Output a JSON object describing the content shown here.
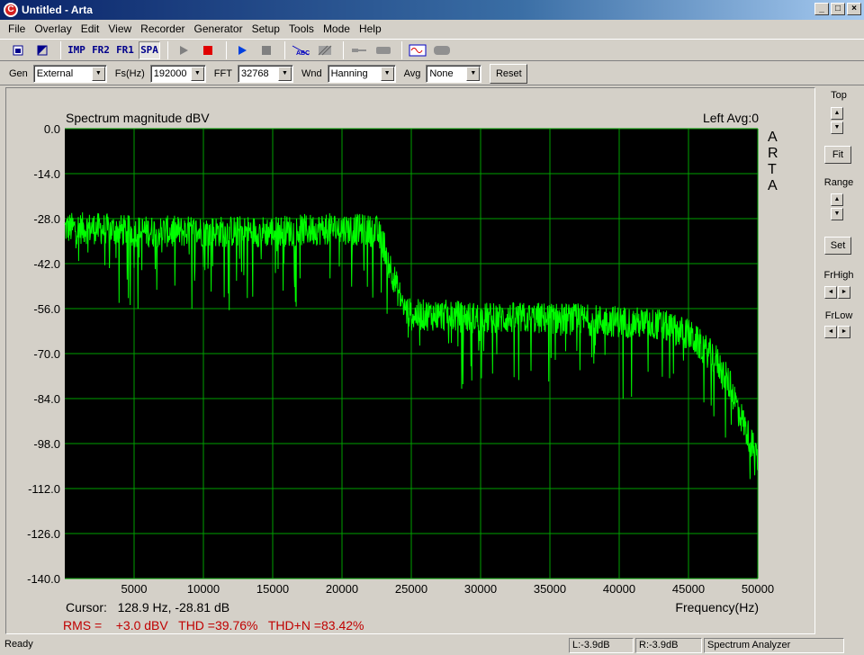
{
  "window": {
    "title": "Untitled - Arta",
    "icon_letter": "C"
  },
  "menu": [
    "File",
    "Overlay",
    "Edit",
    "View",
    "Recorder",
    "Generator",
    "Setup",
    "Tools",
    "Mode",
    "Help"
  ],
  "toolbar": {
    "imp": "IMP",
    "fr2": "FR2",
    "fr1": "FR1",
    "spa": "SPA"
  },
  "params": {
    "gen_label": "Gen",
    "gen_value": "External",
    "fs_label": "Fs(Hz)",
    "fs_value": "192000",
    "fft_label": "FFT",
    "fft_value": "32768",
    "wnd_label": "Wnd",
    "wnd_value": "Hanning",
    "avg_label": "Avg",
    "avg_value": "None",
    "reset_label": "Reset"
  },
  "side": {
    "top_label": "Top",
    "fit_label": "Fit",
    "range_label": "Range",
    "set_label": "Set",
    "frhigh_label": "FrHigh",
    "frlow_label": "FrLow"
  },
  "chart_data": {
    "type": "line",
    "title": "Spectrum magnitude dBV",
    "channel_info": "Left  Avg:0",
    "watermark": "ARTA",
    "xlabel": "Frequency(Hz)",
    "ylabel": "",
    "xlim": [
      0,
      50000
    ],
    "ylim": [
      -140,
      0
    ],
    "xticks": [
      5000,
      10000,
      15000,
      20000,
      25000,
      30000,
      35000,
      40000,
      45000,
      50000
    ],
    "yticks": [
      "0.0",
      "-14.0",
      "-28.0",
      "-42.0",
      "-56.0",
      "-70.0",
      "-84.0",
      "-98.0",
      "-112.0",
      "-126.0",
      "-140.0"
    ],
    "grid": true,
    "background": "#000000",
    "grid_color": "#00a000",
    "series": [
      {
        "color": "#00ff00",
        "x": [
          0,
          2000,
          5000,
          10000,
          15000,
          20000,
          22500,
          23000,
          24000,
          24500,
          25000,
          27000,
          30000,
          35000,
          40000,
          43000,
          45000,
          47000,
          48000,
          49000,
          50000
        ],
        "y": [
          -31,
          -31,
          -32,
          -32,
          -32,
          -31,
          -32,
          -36,
          -50,
          -56,
          -58,
          -58,
          -59,
          -59,
          -60,
          -61,
          -64,
          -72,
          -80,
          -92,
          -103
        ]
      }
    ],
    "cursor": "Cursor:   128.9 Hz, -28.81 dB",
    "rms_line": "RMS =    +3.0 dBV   THD =39.76%   THD+N =83.42%"
  },
  "status": {
    "ready": "Ready",
    "l_level": "L:-3.9dB",
    "r_level": "R:-3.9dB",
    "mode": "Spectrum Analyzer"
  }
}
